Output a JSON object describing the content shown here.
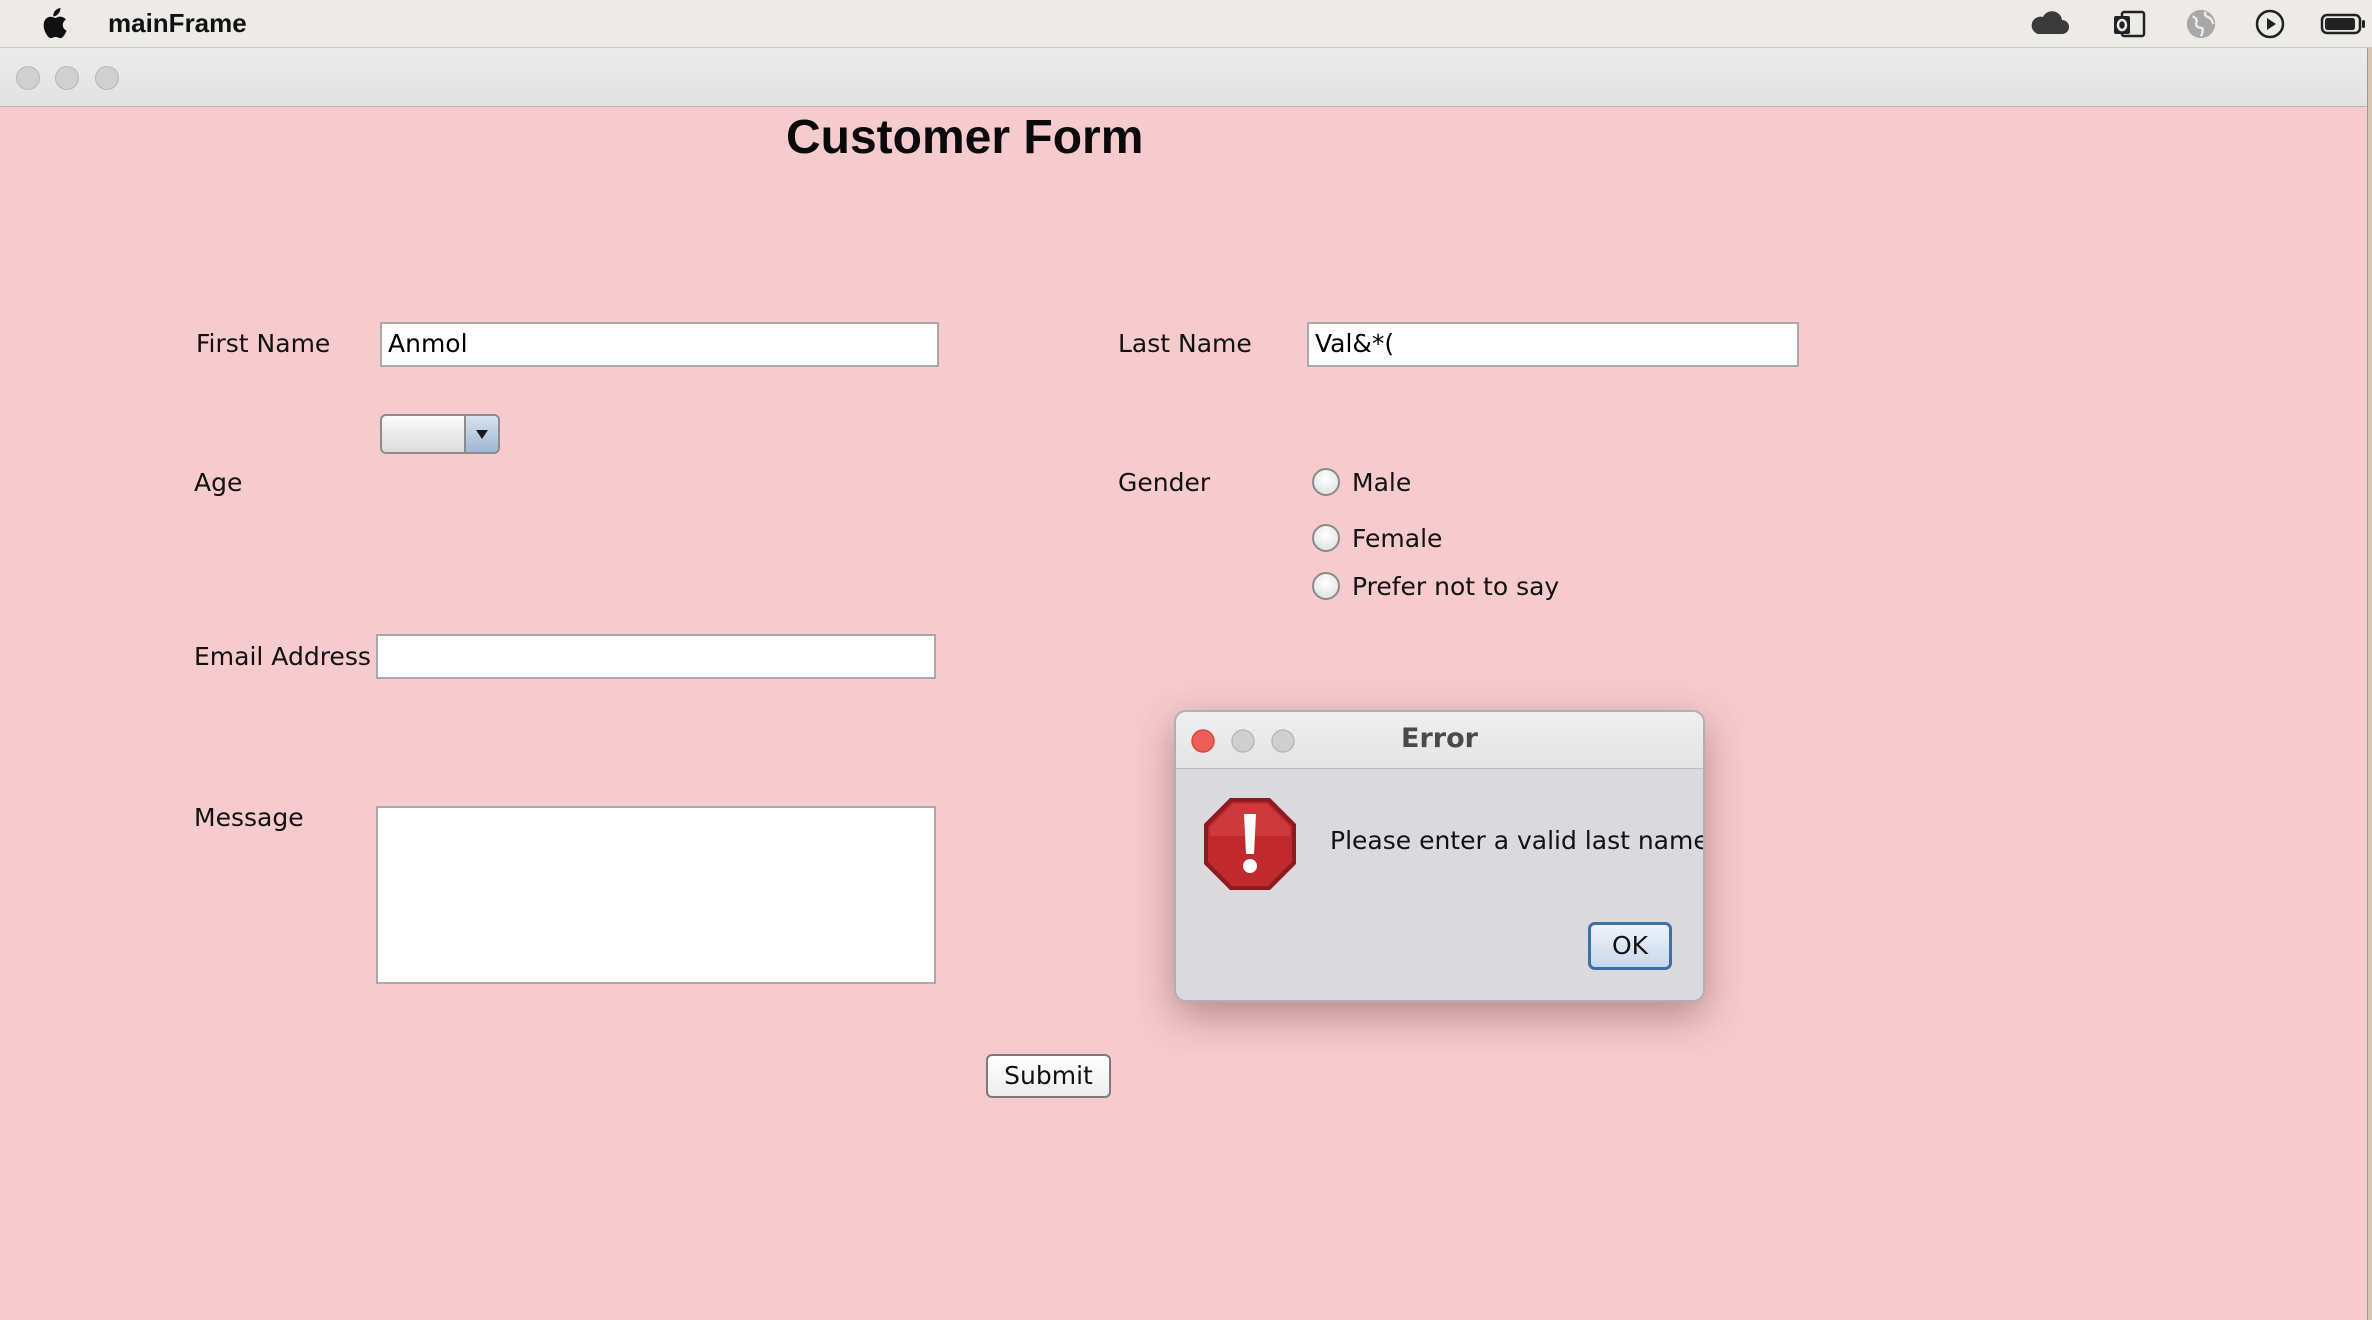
{
  "menubar": {
    "app_name": "mainFrame"
  },
  "form": {
    "title": "Customer Form",
    "first_name": {
      "label": "First Name",
      "value": "Anmol"
    },
    "last_name": {
      "label": "Last Name",
      "value": "Val&*("
    },
    "age": {
      "label": "Age",
      "value": ""
    },
    "gender": {
      "label": "Gender",
      "options": [
        "Male",
        "Female",
        "Prefer not to say"
      ]
    },
    "email": {
      "label": "Email Address",
      "value": ""
    },
    "message": {
      "label": "Message",
      "value": ""
    },
    "submit_label": "Submit"
  },
  "dialog": {
    "title": "Error",
    "message": "Please enter a valid last name",
    "ok_label": "OK"
  },
  "colors": {
    "window_background": "#f6cbcd",
    "error_icon": "#b3262a",
    "ok_button_border": "#3d6faa"
  },
  "icons": {
    "menubar": [
      "apple-logo-icon"
    ],
    "tray": [
      "cloud-icon",
      "outlook-icon",
      "globe-icon",
      "play-circle-icon",
      "battery-icon"
    ],
    "dialog": [
      "error-stop-icon"
    ]
  }
}
